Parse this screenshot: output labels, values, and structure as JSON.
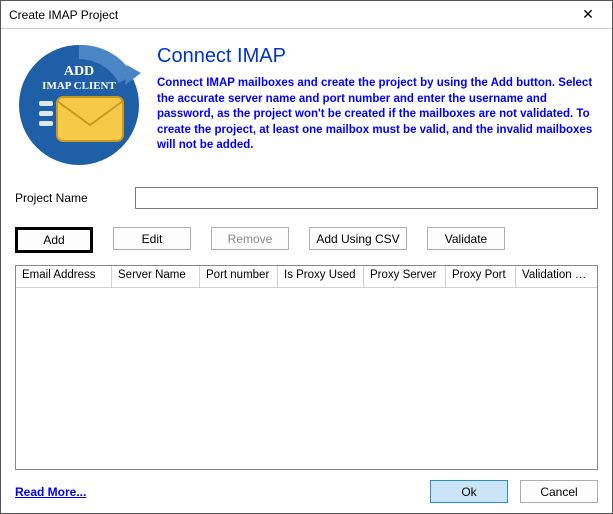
{
  "window": {
    "title": "Create IMAP Project",
    "close_glyph": "✕"
  },
  "logo": {
    "line1": "ADD",
    "line2": "IMAP CLIENT"
  },
  "header": {
    "title": "Connect IMAP",
    "description": "Connect IMAP mailboxes and create the project  by using the Add button. Select the accurate server name and port number and enter the username and password, as the project won't be created if the mailboxes are not validated.  To create the project, at least one mailbox must be valid, and the invalid mailboxes will not be added."
  },
  "form": {
    "project_name_label": "Project Name",
    "project_name_value": ""
  },
  "buttons": {
    "add": "Add",
    "edit": "Edit",
    "remove": "Remove",
    "add_csv": "Add Using CSV",
    "validate": "Validate"
  },
  "grid": {
    "columns": [
      "Email Address",
      "Server Name",
      "Port number",
      "Is Proxy Used",
      "Proxy Server",
      "Proxy Port",
      "Validation Stat..."
    ],
    "rows": []
  },
  "footer": {
    "read_more": "Read More...",
    "ok": "Ok",
    "cancel": "Cancel"
  }
}
